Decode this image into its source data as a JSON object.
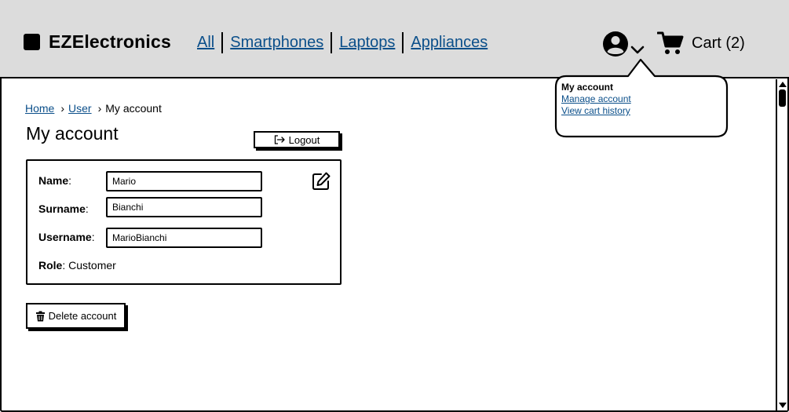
{
  "header": {
    "brand": "EZElectronics",
    "nav": [
      {
        "label": "All"
      },
      {
        "label": "Smartphones"
      },
      {
        "label": "Laptops"
      },
      {
        "label": "Appliances"
      }
    ],
    "cart_label": "Cart (2)",
    "icons": {
      "user": "user-circle-icon",
      "dropdown": "chevron-down-icon",
      "cart": "cart-icon"
    }
  },
  "dropdown": {
    "title": "My account",
    "links": [
      "Manage account",
      "View cart history"
    ]
  },
  "breadcrumb": {
    "items": [
      "Home",
      "User"
    ],
    "current": "My account",
    "separator": "›"
  },
  "page": {
    "title": "My account",
    "logout_label": "Logout",
    "delete_label": "Delete account"
  },
  "account": {
    "name_label": "Name",
    "name_value": "Mario",
    "surname_label": "Surname",
    "surname_value": "Bianchi",
    "username_label": "Username",
    "username_value": "MarioBianchi",
    "role_label": "Role",
    "role_value": "Customer"
  },
  "colors": {
    "header_bg": "#dcdcdc",
    "link": "#0b4f8a"
  }
}
